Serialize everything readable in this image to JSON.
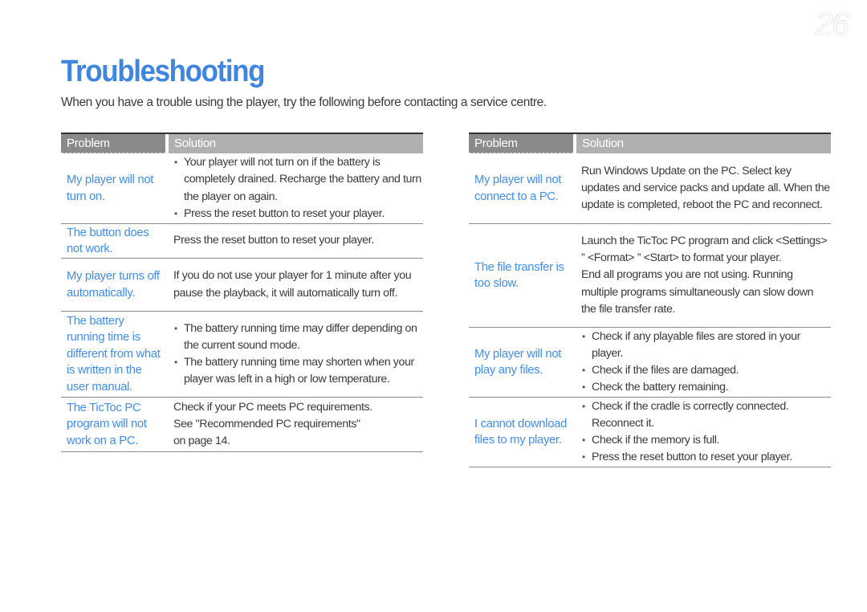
{
  "page": {
    "number": "26",
    "title": "Troubleshooting",
    "intro": "When you have a trouble using the player, try the following before contacting a service centre."
  },
  "colors": {
    "accent": "#3e86e0",
    "problem_text": "#3e8ef0",
    "header_problem_bg": "#8a8a8a",
    "header_solution_bg": "#b0b0b0"
  },
  "tables": [
    {
      "header": {
        "problem": "Problem",
        "solution": "Solution"
      },
      "rows": [
        {
          "problem": "My player will not turn on.",
          "solution_type": "bullets",
          "solution": [
            "Your player will not turn on if the battery is completely drained. Recharge the battery and turn the player on again.",
            "Press the reset button to reset your player."
          ]
        },
        {
          "problem": "The button does not work.",
          "solution_type": "text",
          "solution": [
            "Press the reset button to reset your player."
          ]
        },
        {
          "problem": "My player turns off automatically.",
          "solution_type": "text",
          "solution": [
            "If you do not use your player for 1 minute after you pause the playback, it will automatically turn off."
          ]
        },
        {
          "problem": "The battery running time is different from what is written in the user manual.",
          "solution_type": "bullets",
          "solution": [
            "The battery running time may differ depending on the current sound mode.",
            "The battery running time may shorten when your player was left in a high or low temperature."
          ]
        },
        {
          "problem": "The TicToc PC program will not work on a PC.",
          "solution_type": "text",
          "solution": [
            "Check if your PC meets PC requirements.",
            "See \"Recommended PC requirements\"",
            "on page 14."
          ]
        }
      ]
    },
    {
      "header": {
        "problem": "Problem",
        "solution": "Solution"
      },
      "rows": [
        {
          "problem": "My player will not connect to a PC.",
          "solution_type": "text",
          "solution": [
            "Run Windows Update on the PC. Select key updates and service packs and update all. When the update is completed, reboot the PC and reconnect."
          ]
        },
        {
          "problem": "The file transfer is too slow.",
          "solution_type": "text",
          "solution": [
            "Launch the TicToc PC program and click <Settings> ” <Format> ” <Start> to format your player.",
            "End all programs you are not using. Running multiple programs simultaneously can slow down the file transfer rate."
          ]
        },
        {
          "problem": "My player will not play any files.",
          "solution_type": "bullets",
          "solution": [
            "Check if any playable files are stored in your player.",
            "Check if the files are damaged.",
            "Check the battery remaining."
          ]
        },
        {
          "problem": "I cannot download files to my player.",
          "solution_type": "bullets",
          "solution": [
            "Check if the cradle is correctly connected. Reconnect it.",
            "Check if the memory is full.",
            "Press the reset button to reset your player."
          ]
        }
      ]
    }
  ]
}
